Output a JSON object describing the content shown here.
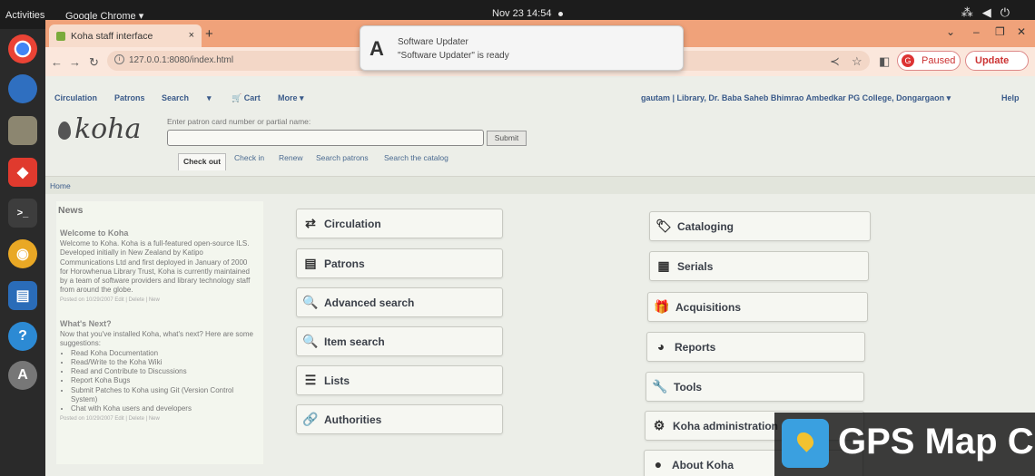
{
  "topbar": {
    "activities": "Activities",
    "app_menu": "Google Chrome ▾",
    "clock": "Nov 23  14:54",
    "tray_icons": [
      "network-icon",
      "volume-icon",
      "power-icon"
    ]
  },
  "dock": {
    "items": [
      "chrome-icon",
      "thunderbird-icon",
      "files-icon",
      "anydesk-icon",
      "terminal-icon",
      "rhythmbox-icon",
      "writer-icon",
      "help-icon",
      "software-updater-icon"
    ]
  },
  "browser": {
    "tab_title": "Koha staff interface",
    "tab_close": "×",
    "new_tab": "+",
    "url": "127.0.0.1:8080/index.html",
    "profile_initial": "G",
    "profile_status": "Paused",
    "update_label": "Update",
    "accent": "#f0a27a"
  },
  "notification": {
    "title": "Software Updater",
    "body": "\"Software Updater\" is ready"
  },
  "koha": {
    "nav": [
      "Circulation",
      "Patrons",
      "Search",
      "▾",
      "🛒 Cart",
      "More ▾"
    ],
    "user_library": "gautam  |  Library, Dr. Baba Saheb Bhimrao Ambedkar PG College, Dongargaon ▾",
    "help": "Help",
    "logo": "koha",
    "card_label": "Enter patron card number or partial name:",
    "card_value": "",
    "submit": "Submit",
    "search_tabs": [
      "Check out",
      "Check in",
      "Renew",
      "Search patrons",
      "Search the catalog"
    ],
    "breadcrumb": "Home",
    "news": {
      "heading": "News",
      "items": [
        {
          "title": "Welcome to Koha",
          "body": "Welcome to Koha. Koha is a full-featured open-source ILS. Developed initially in New Zealand by Katipo Communications Ltd and first deployed in January of 2000 for Horowhenua Library Trust, Koha is currently maintained by a team of software providers and library technology staff from around the globe.",
          "posted": "Posted on 10/29/2007 Edit | Delete | New"
        },
        {
          "title": "What's Next?",
          "body": "Now that you've installed Koha, what's next? Here are some suggestions:",
          "bullets": [
            "Read Koha Documentation",
            "Read/Write to the Koha Wiki",
            "Read and Contribute to Discussions",
            "Report Koha Bugs",
            "Submit Patches to Koha using Git (Version Control System)",
            "Chat with Koha users and developers"
          ],
          "posted": "Posted on 10/29/2007 Edit | Delete | New"
        }
      ]
    },
    "modules_left": [
      {
        "label": "Circulation",
        "icon": "⇄"
      },
      {
        "label": "Patrons",
        "icon": "▤"
      },
      {
        "label": "Advanced search",
        "icon": "🔍"
      },
      {
        "label": "Item search",
        "icon": "🔍"
      },
      {
        "label": "Lists",
        "icon": "☰"
      },
      {
        "label": "Authorities",
        "icon": "🔗"
      }
    ],
    "modules_right": [
      {
        "label": "Cataloging",
        "icon": "🏷"
      },
      {
        "label": "Serials",
        "icon": "▦"
      },
      {
        "label": "Acquisitions",
        "icon": "🎁"
      },
      {
        "label": "Reports",
        "icon": "◕"
      },
      {
        "label": "Tools",
        "icon": "🔧"
      },
      {
        "label": "Koha administration",
        "icon": "⚙"
      },
      {
        "label": "About Koha",
        "icon": "●"
      }
    ]
  },
  "watermark": {
    "text": "GPS Map C"
  }
}
